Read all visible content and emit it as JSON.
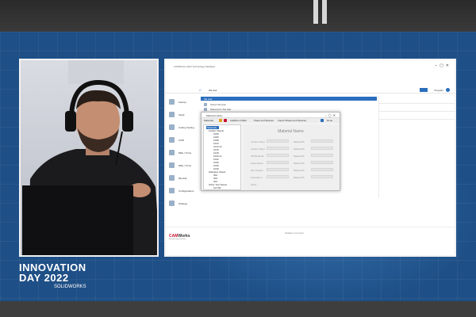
{
  "branding": {
    "event_line1": "INNOVATION",
    "event_line2": "DAY 2022",
    "company": "SOLIDWORKS"
  },
  "app": {
    "window_title": "CAMWorks 2022 Technology Database",
    "command_title": "Ma Hak",
    "primary_button": "Select",
    "version_label": "Program",
    "logo_cam": "CAM",
    "logo_works": "Works",
    "logo_sub": "Manufacturing Software",
    "status": "Database Connected"
  },
  "sidebar": {
    "items": [
      {
        "label": "Factory",
        "icon": "factory-icon"
      },
      {
        "label": "Stock",
        "icon": "stock-icon"
      },
      {
        "label": "Cutting Tooling",
        "icon": "tool-icon"
      },
      {
        "label": "COM",
        "icon": "gear-icon"
      },
      {
        "label": "Mills / Turns",
        "icon": "mill-icon"
      },
      {
        "label": "Mills / Turns",
        "icon": "turn-icon"
      },
      {
        "label": "Ma Hak",
        "icon": "material-icon"
      },
      {
        "label": "Configurations",
        "icon": "config-icon"
      },
      {
        "label": "Strategy",
        "icon": "strategy-icon"
      }
    ]
  },
  "main": {
    "banner": "Ma Hak",
    "options": [
      "Select Ma Hak",
      "Material for Ma Hak"
    ]
  },
  "dialog": {
    "title": "Material Library",
    "toolbar": [
      "Materials",
      "Add/Rem Pallet",
      "Paste and Species",
      "Import Sheets and Species",
      "Done"
    ],
    "tree": [
      {
        "label": "Materials",
        "level": 0,
        "selected": true
      },
      {
        "label": "Carbon Steels",
        "level": 1
      },
      {
        "label": "1005",
        "level": 2
      },
      {
        "label": "1006",
        "level": 2
      },
      {
        "label": "1008",
        "level": 2
      },
      {
        "label": "1010",
        "level": 2
      },
      {
        "label": "1012 Hi",
        "level": 2
      },
      {
        "label": "1015",
        "level": 2
      },
      {
        "label": "1018",
        "level": 2
      },
      {
        "label": "1020 Hi",
        "level": 2
      },
      {
        "label": "1022",
        "level": 2
      },
      {
        "label": "1030",
        "level": 2
      },
      {
        "label": "1035",
        "level": 2
      },
      {
        "label": "1040",
        "level": 2
      },
      {
        "label": "Stainless Steels",
        "level": 1
      },
      {
        "label": "302",
        "level": 2
      },
      {
        "label": "303",
        "level": 2
      },
      {
        "label": "304",
        "level": 2
      },
      {
        "label": "Other Tool Steels",
        "level": 1
      },
      {
        "label": "A2 HW",
        "level": 2
      }
    ],
    "heading": "Material Name",
    "fields": [
      "Carbon Steel",
      "Material B",
      "Carbon Steel",
      "Material B",
      "SFPM Mode",
      "Material B",
      "Feed Factor",
      "Material B",
      "Rpm Factor",
      "Material B",
      "Feedrate A",
      "Material B",
      "Other"
    ]
  }
}
